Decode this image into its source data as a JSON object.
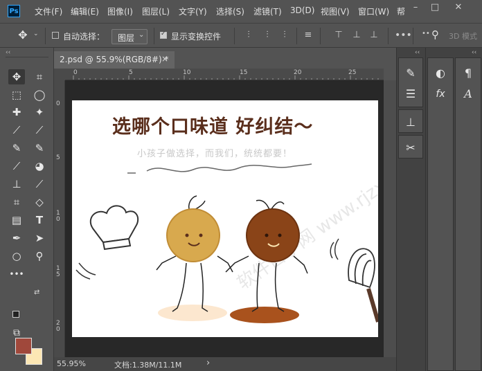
{
  "app": {
    "logo_text": "Ps"
  },
  "menu": {
    "items": [
      "文件(F)",
      "编辑(E)",
      "图像(I)",
      "图层(L)",
      "文字(Y)",
      "选择(S)",
      "滤镜(T)",
      "3D(D)",
      "视图(V)",
      "窗口(W)",
      "帮"
    ]
  },
  "options": {
    "auto_select_label": "自动选择：",
    "auto_select_checked": false,
    "target_value": "图层",
    "show_transform_label": "显示变换控件",
    "show_transform_checked": true,
    "mode_3d_label": "3D 模式"
  },
  "document": {
    "tab_title": "2.psd @ 55.9%(RGB/8#) *",
    "close_glyph": "×",
    "hruler_labels": [
      "0",
      "5",
      "10",
      "15",
      "20",
      "25"
    ],
    "vruler_labels": [
      "0",
      "5",
      "1 0",
      "1 5",
      "2 0"
    ]
  },
  "artwork": {
    "title": "选哪个口味道 好纠结～",
    "subtitle": "小孩子做选择，而我们，统统都要！",
    "watermark": "软件自学网 www.rjzxw.com"
  },
  "status": {
    "zoom": "55.95%",
    "doc_size": "文档:1.38M/11.1M",
    "arrow": "›"
  },
  "colors": {
    "foreground": "#a0483b",
    "background": "#fce7b4",
    "cookie_light": "#d8a94e",
    "cookie_dark": "#8a4418"
  },
  "tools": [
    "move-tool-icon",
    "artboard-tool-icon",
    "marquee-tool-icon",
    "lasso-tool-icon",
    "quick-select-icon",
    "magic-wand-icon",
    "crop-icon",
    "eyedropper-icon",
    "healing-brush-icon",
    "brush-icon",
    "clone-stamp-icon",
    "history-brush-icon",
    "eraser-icon",
    "gradient-icon",
    "blur-icon",
    "dodge-icon",
    "pen-icon",
    "type-icon",
    "path-select-icon",
    "shape-icon",
    "hand-icon",
    "zoom-icon",
    "more-tools-icon",
    "screen-mode-icon"
  ]
}
